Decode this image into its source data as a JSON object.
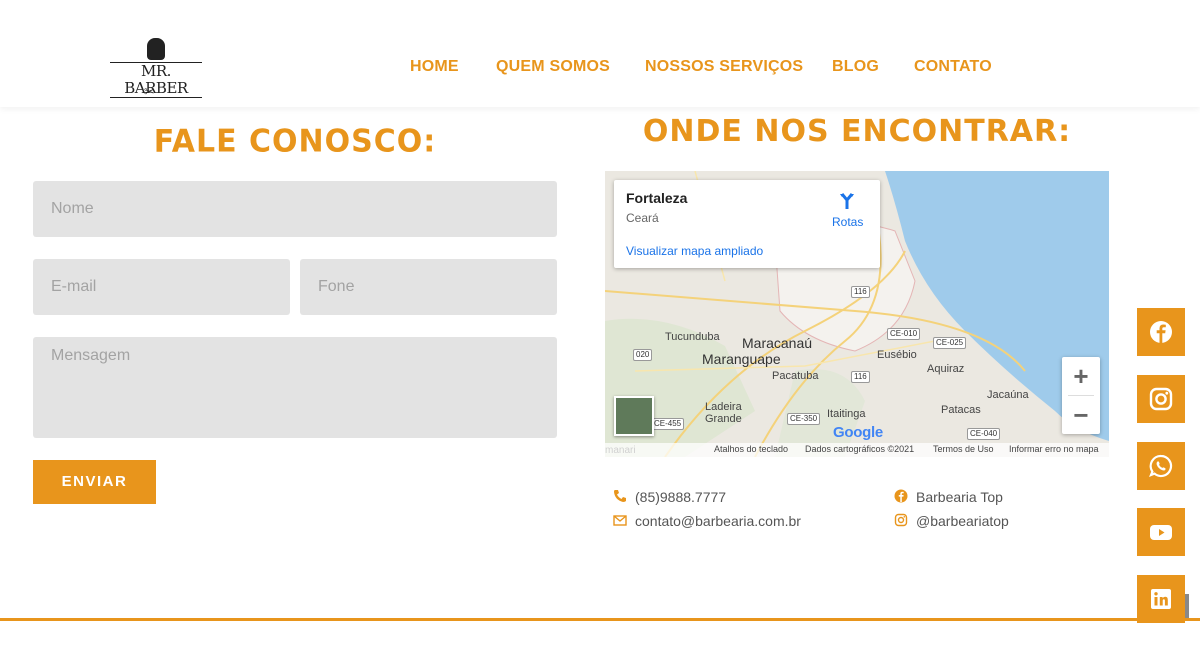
{
  "brand": {
    "logo_text": "MR. BARBER"
  },
  "nav": [
    {
      "label": "HOME"
    },
    {
      "label": "QUEM SOMOS"
    },
    {
      "label": "NOSSOS SERVIÇOS"
    },
    {
      "label": "BLOG"
    },
    {
      "label": "CONTATO"
    }
  ],
  "form": {
    "title": "FALE CONOSCO:",
    "name_placeholder": "Nome",
    "email_placeholder": "E-mail",
    "phone_placeholder": "Fone",
    "message_placeholder": "Mensagem",
    "submit_label": "ENVIAR"
  },
  "map": {
    "title": "ONDE NOS ENCONTRAR:",
    "card": {
      "city": "Fortaleza",
      "state": "Ceará",
      "route_label": "Rotas",
      "enlarge_link": "Visualizar mapa ampliado"
    },
    "labels": {
      "maracanau": "Maracanaú",
      "maranguape": "Maranguape",
      "tucunduba": "Tucunduba",
      "pacatuba": "Pacatuba",
      "eusebio": "Eusébio",
      "aquiraz": "Aquiraz",
      "jacauna": "Jacaúna",
      "patacas": "Patacas",
      "itaitinga": "Itaitinga",
      "ladeira_grande": "Ladeira\nGrande",
      "manari": "manari"
    },
    "roads": {
      "r116a": "116",
      "r116b": "116",
      "ce010": "CE-010",
      "ce025": "CE-025",
      "r020": "020",
      "ce350": "CE-350",
      "ce455": "CE-455",
      "ce040": "CE-040"
    },
    "google": "Google",
    "footer": {
      "shortcuts": "Atalhos do teclado",
      "data": "Dados cartográficos ©2021",
      "terms": "Termos de Uso",
      "report": "Informar erro no mapa"
    },
    "zoom_in": "+",
    "zoom_out": "−"
  },
  "contact": {
    "phone": "(85)9888.7777",
    "email": "contato@barbearia.com.br",
    "facebook": "Barbearia Top",
    "instagram": "@barbeariatop"
  },
  "social": [
    "facebook-icon",
    "instagram-icon",
    "whatsapp-icon",
    "youtube-icon",
    "linkedin-icon"
  ],
  "colors": {
    "accent": "#e8951c",
    "field_bg": "#e3e3e3",
    "map_water": "#9fcbeb"
  }
}
